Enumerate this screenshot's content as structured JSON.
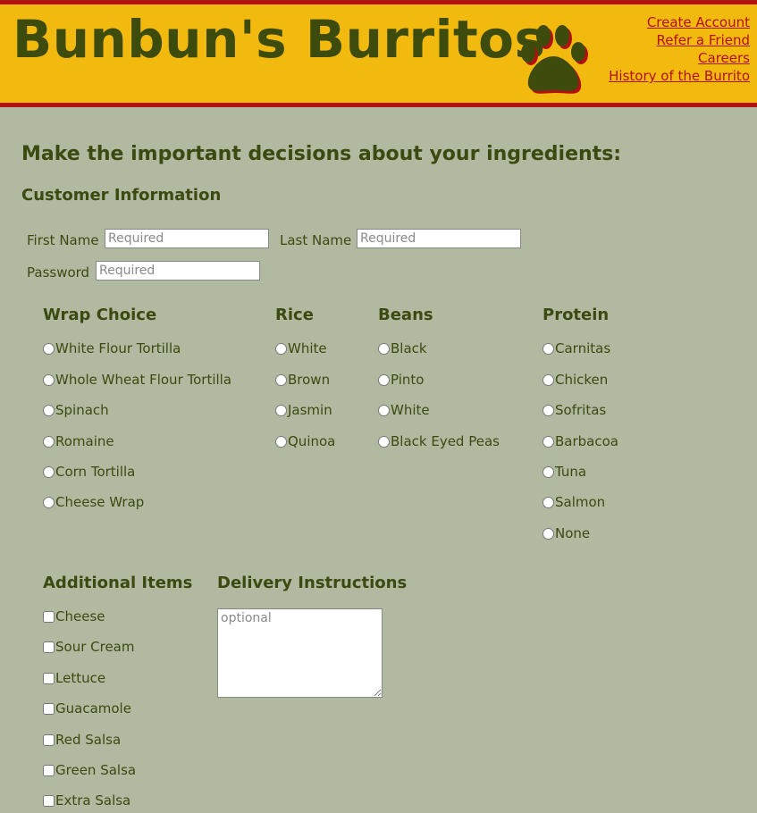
{
  "header": {
    "brand": "Bunbun's Burritos",
    "links": [
      "Create Account",
      "Refer a Friend",
      "Careers",
      "History of the Burrito"
    ],
    "colors": {
      "bar": "#f2b90f",
      "border": "#b31111",
      "text": "#3d4b0c"
    },
    "logo_icon": "paw-icon"
  },
  "page": {
    "heading": "Make the important decisions about your ingredients:",
    "customer_info": "Customer Information",
    "first_name_label": "First Name",
    "last_name_label": "Last Name",
    "password_label": "Password",
    "required_placeholder": "Required"
  },
  "wrap": {
    "title": "Wrap Choice",
    "options": [
      "White Flour Tortilla",
      "Whole Wheat Flour Tortilla",
      "Spinach",
      "Romaine",
      "Corn Tortilla",
      "Cheese Wrap"
    ]
  },
  "rice": {
    "title": "Rice",
    "options": [
      "White",
      "Brown",
      "Jasmin",
      "Quinoa"
    ]
  },
  "beans": {
    "title": "Beans",
    "options": [
      "Black",
      "Pinto",
      "White",
      "Black Eyed Peas"
    ]
  },
  "protein": {
    "title": "Protein",
    "options": [
      "Carnitas",
      "Chicken",
      "Sofritas",
      "Barbacoa",
      "Tuna",
      "Salmon",
      "None"
    ]
  },
  "additional": {
    "title": "Additional Items",
    "options": [
      "Cheese",
      "Sour Cream",
      "Lettuce",
      "Guacamole",
      "Red Salsa",
      "Green Salsa",
      "Extra Salsa"
    ]
  },
  "delivery": {
    "title": "Delivery Instructions",
    "placeholder": "optional"
  }
}
